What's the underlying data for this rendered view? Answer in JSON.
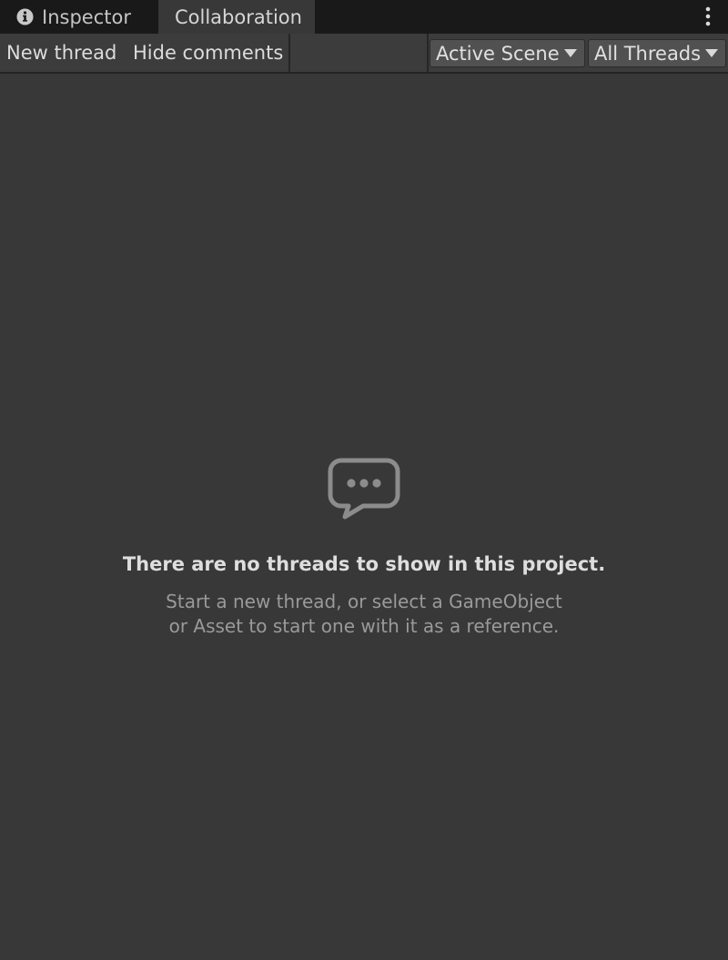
{
  "tabs": [
    {
      "label": "Inspector",
      "icon": "info-icon",
      "active": false
    },
    {
      "label": "Collaboration",
      "active": true
    }
  ],
  "window_menu_icon": "kebab-menu-icon",
  "toolbar": {
    "new_thread_label": "New thread",
    "hide_comments_label": "Hide comments",
    "scope_dropdown": {
      "selected": "Active Scene"
    },
    "filter_dropdown": {
      "selected": "All Threads"
    }
  },
  "empty_state": {
    "icon": "chat-bubble-icon",
    "title": "There are no threads to show in this project.",
    "description_line1": "Start a new thread, or select a GameObject",
    "description_line2": "or Asset to start one with it as a reference."
  },
  "colors": {
    "background": "#383838",
    "tabbar": "#191919",
    "dropdown": "#515151",
    "icon_gray": "#8c8c8c"
  }
}
